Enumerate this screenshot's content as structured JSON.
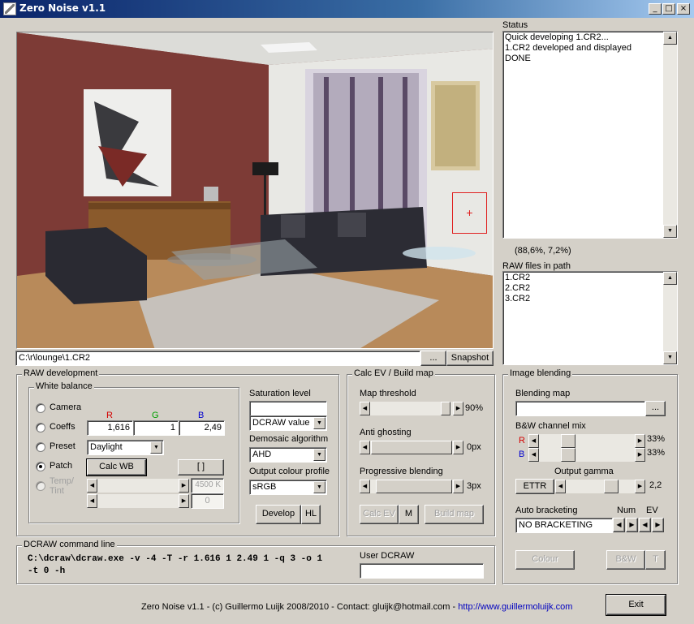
{
  "window": {
    "title": "Zero Noise v1.1",
    "min_glyph": "_",
    "max_glyph": "□",
    "close_glyph": "×"
  },
  "preview": {
    "path": "C:\\r\\lounge\\1.CR2",
    "browse_label": "...",
    "snapshot_label": "Snapshot",
    "crosshair": "+"
  },
  "status": {
    "label": "Status",
    "lines": [
      "Quick developing 1.CR2...",
      "1.CR2 developed and displayed",
      "DONE"
    ],
    "coords": "(88,6%, 7,2%)"
  },
  "raw_files": {
    "label": "RAW files in path",
    "items": [
      "1.CR2",
      "2.CR2",
      "3.CR2"
    ]
  },
  "raw_dev": {
    "legend": "RAW development",
    "wb_legend": "White balance",
    "rgb_r": "R",
    "rgb_g": "G",
    "rgb_b": "B",
    "options": [
      "Camera",
      "Coeffs",
      "Preset",
      "Patch",
      "Temp/\nTint"
    ],
    "selected": "Patch",
    "coeff_r": "1,616",
    "coeff_g": "1",
    "coeff_b": "2,49",
    "preset": "Daylight",
    "calc_wb": "Calc WB",
    "bracket_btn": "[ ]",
    "temp_value": "4500 K",
    "tint_value": "0",
    "saturation_label": "Saturation level",
    "saturation_value": "",
    "saturation_mode": "DCRAW value",
    "demosaic_label": "Demosaic algorithm",
    "demosaic_value": "AHD",
    "profile_label": "Output colour profile",
    "profile_value": "sRGB",
    "develop": "Develop",
    "hl": "HL"
  },
  "calc_ev": {
    "legend": "Calc EV / Build map",
    "map_threshold_label": "Map threshold",
    "map_threshold_value": "90%",
    "anti_ghosting_label": "Anti ghosting",
    "anti_ghosting_value": "0px",
    "progressive_label": "Progressive blending",
    "progressive_value": "3px",
    "calc_ev_btn": "Calc EV",
    "m_btn": "M",
    "build_map_btn": "Build map"
  },
  "blending": {
    "legend": "Image blending",
    "map_label": "Blending map",
    "map_value": "",
    "browse": "...",
    "bw_label": "B&W channel mix",
    "r_label": "R",
    "b_label": "B",
    "r_pct": "33%",
    "b_pct": "33%",
    "gamma_label": "Output gamma",
    "ettr": "ETTR",
    "gamma_value": "2,2",
    "auto_label": "Auto bracketing",
    "num_label": "Num",
    "ev_label": "EV",
    "bracketing_value": "NO BRACKETING",
    "colour_btn": "Colour",
    "bw_btn": "B&W",
    "t_btn": "T"
  },
  "dcraw": {
    "legend": "DCRAW command line",
    "command_line1": "C:\\dcraw\\dcraw.exe -v -4 -T -r 1.616 1 2.49 1 -q 3 -o 1",
    "command_line2": "-t 0 -h",
    "user_label": "User DCRAW",
    "user_value": ""
  },
  "footer": {
    "credit": "Zero Noise v1.1 - (c) Guillermo Luijk 2008/2010 - Contact: gluijk@hotmail.com - ",
    "url": "http://www.guillermoluijk.com",
    "exit": "Exit"
  },
  "colors": {
    "r_label": "#d40000",
    "g_label": "#00a000",
    "b_label": "#0000d0",
    "link": "#0000c0",
    "title_bar": "#0a246a"
  }
}
